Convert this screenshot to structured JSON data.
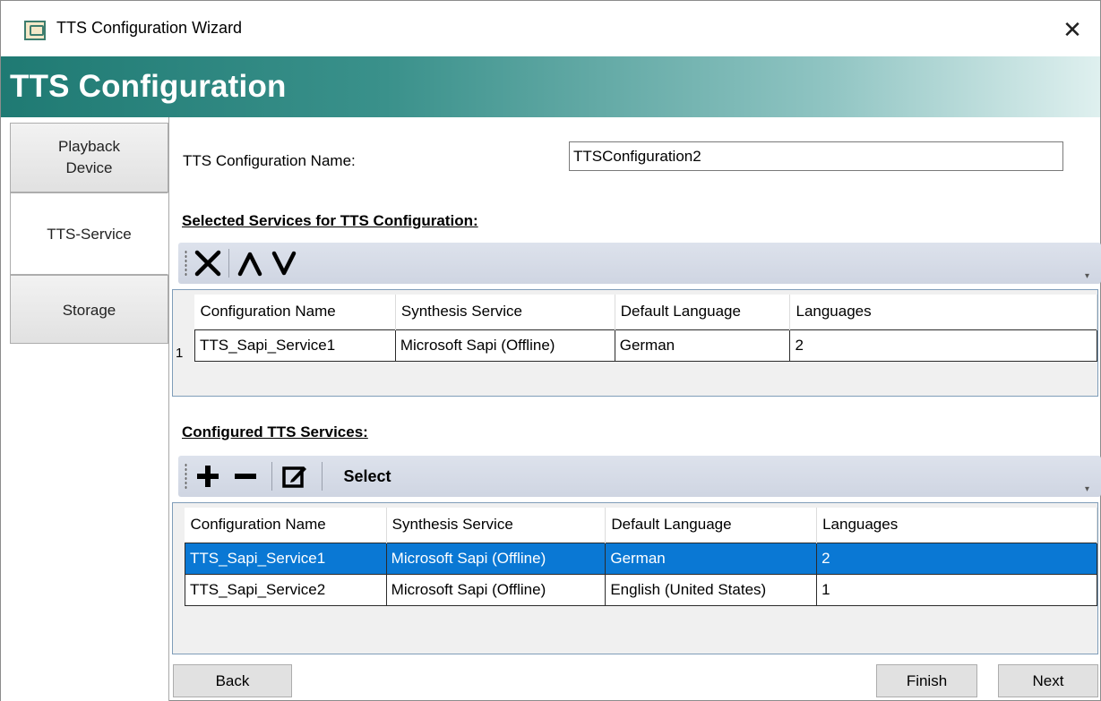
{
  "window": {
    "title": "TTS Configuration Wizard",
    "close_glyph": "✕"
  },
  "banner": {
    "title": "TTS Configuration"
  },
  "nav": {
    "items": [
      {
        "label_line1": "Playback",
        "label_line2": "Device"
      },
      {
        "label": "TTS-Service",
        "active": true
      },
      {
        "label": "Storage"
      }
    ]
  },
  "form": {
    "name_label": "TTS Configuration Name:",
    "name_value": "TTSConfiguration2"
  },
  "selected": {
    "heading": "Selected Services for TTS Configuration:",
    "toolbar": {
      "icons": [
        "remove-x-icon",
        "move-up-icon",
        "move-down-icon"
      ]
    },
    "columns": [
      "Configuration Name",
      "Synthesis Service",
      "Default Language",
      "Languages"
    ],
    "rows": [
      {
        "row_number": "1",
        "cells": [
          "TTS_Sapi_Service1",
          "Microsoft Sapi (Offline)",
          "German",
          "2"
        ]
      }
    ]
  },
  "configured": {
    "heading": "Configured TTS Services:",
    "toolbar": {
      "select_label": "Select",
      "icons": [
        "add-icon",
        "minus-icon",
        "edit-icon"
      ]
    },
    "columns": [
      "Configuration Name",
      "Synthesis Service",
      "Default Language",
      "Languages"
    ],
    "rows": [
      {
        "cells": [
          "TTS_Sapi_Service1",
          "Microsoft Sapi (Offline)",
          "German",
          "2"
        ],
        "selected": true
      },
      {
        "cells": [
          "TTS_Sapi_Service2",
          "Microsoft Sapi (Offline)",
          "English (United States)",
          "1"
        ],
        "selected": false
      }
    ]
  },
  "buttons": {
    "back": "Back",
    "finish": "Finish",
    "next": "Next"
  },
  "colors": {
    "accent": "#0a78d4",
    "banner": "#1f7a73"
  }
}
